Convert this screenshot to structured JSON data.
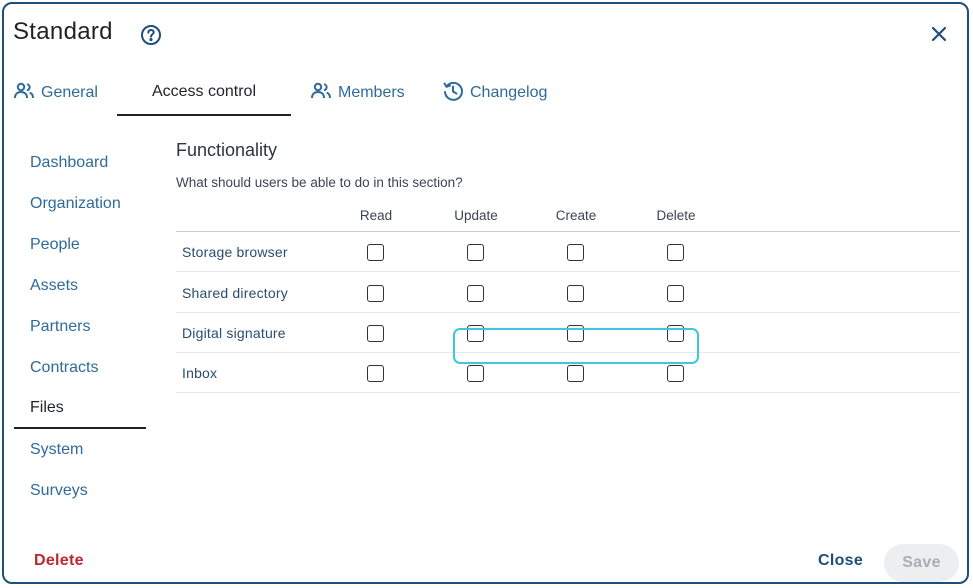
{
  "dialog": {
    "title": "Standard",
    "help_icon": "question-circle-icon",
    "close_icon": "close-x-icon"
  },
  "tabs": [
    {
      "label": "General",
      "icon": "users-icon",
      "active": false
    },
    {
      "label": "Access control",
      "icon": "",
      "active": true
    },
    {
      "label": "Members",
      "icon": "users-icon",
      "active": false
    },
    {
      "label": "Changelog",
      "icon": "history-clock-icon",
      "active": false
    }
  ],
  "sidebar": {
    "items": [
      {
        "label": "Dashboard",
        "active": false
      },
      {
        "label": "Organization",
        "active": false
      },
      {
        "label": "People",
        "active": false
      },
      {
        "label": "Assets",
        "active": false
      },
      {
        "label": "Partners",
        "active": false
      },
      {
        "label": "Contracts",
        "active": false
      },
      {
        "label": "Files",
        "active": true
      },
      {
        "label": "System",
        "active": false
      },
      {
        "label": "Surveys",
        "active": false
      }
    ]
  },
  "section": {
    "title": "Functionality",
    "description": "What should users be able to do in this section?"
  },
  "permissions": {
    "columns": [
      "Read",
      "Update",
      "Create",
      "Delete"
    ],
    "rows": [
      {
        "label": "Storage browser",
        "values": [
          false,
          false,
          false,
          false
        ]
      },
      {
        "label": "Shared directory",
        "values": [
          false,
          false,
          false,
          false
        ]
      },
      {
        "label": "Digital signature",
        "values": [
          false,
          false,
          false,
          false
        ]
      },
      {
        "label": "Inbox",
        "values": [
          false,
          false,
          false,
          false
        ]
      }
    ]
  },
  "footer": {
    "delete_label": "Delete",
    "close_label": "Close",
    "save_label": "Save",
    "save_disabled": true
  },
  "colors": {
    "primary": "#1e4f7a",
    "link": "#2f6b9a",
    "danger": "#c0262d",
    "focus_ring": "#3fc6d9",
    "disabled_bg": "#eceef0"
  }
}
